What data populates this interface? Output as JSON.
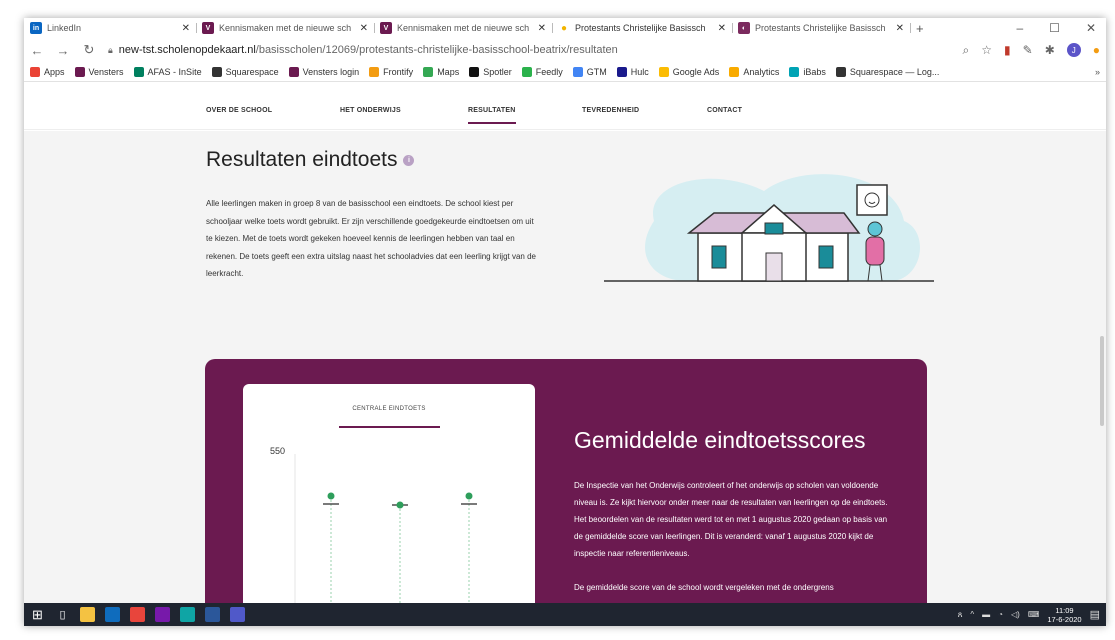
{
  "browser": {
    "tabs": [
      {
        "label": "LinkedIn",
        "icon": "linkedin-icon",
        "color": "#0a66c2",
        "glyph": "in",
        "active": false
      },
      {
        "label": "Kennismaken met de nieuwe sch",
        "icon": "vensters-icon",
        "color": "#6b1a50",
        "glyph": "V",
        "active": false
      },
      {
        "label": "Kennismaken met de nieuwe sch",
        "icon": "vensters-icon",
        "color": "#6b1a50",
        "glyph": "V",
        "active": false
      },
      {
        "label": "Protestants Christelijke Basissch",
        "icon": "scholen-icon",
        "color": "#f2b400",
        "glyph": "●",
        "active": true
      },
      {
        "label": "Protestants Christelijke Basissch",
        "icon": "scholen-icon",
        "color": "#7b2a5e",
        "glyph": "◐",
        "active": false
      }
    ],
    "new_tab": "+",
    "window_controls": [
      "–",
      "☐",
      "✕"
    ],
    "url_domain": "new-tst.scholenopdekaart.nl",
    "url_path": "/basisscholen/12069/protestants-christelijke-basisschool-beatrix/resultaten",
    "account_initial": "J",
    "bookmarks": [
      {
        "label": "Apps",
        "color": "#ea4335"
      },
      {
        "label": "Vensters",
        "color": "#6b1a50"
      },
      {
        "label": "AFAS - InSite",
        "color": "#00805f"
      },
      {
        "label": "Squarespace",
        "color": "#333333"
      },
      {
        "label": "Vensters login",
        "color": "#6b1a50"
      },
      {
        "label": "Frontify",
        "color": "#f39c12"
      },
      {
        "label": "Maps",
        "color": "#34a853"
      },
      {
        "label": "Spotler",
        "color": "#111111"
      },
      {
        "label": "Feedly",
        "color": "#2bb24c"
      },
      {
        "label": "GTM",
        "color": "#4285f4"
      },
      {
        "label": "Hulc",
        "color": "#1a1a8c"
      },
      {
        "label": "Google Ads",
        "color": "#fbbc04"
      },
      {
        "label": "Analytics",
        "color": "#f9ab00"
      },
      {
        "label": "iBabs",
        "color": "#00a3b4"
      },
      {
        "label": "Squarespace — Log...",
        "color": "#333333"
      }
    ],
    "bookmarks_more": "»"
  },
  "site_nav": [
    {
      "label": "OVER DE SCHOOL",
      "active": false
    },
    {
      "label": "HET ONDERWIJS",
      "active": false
    },
    {
      "label": "RESULTATEN",
      "active": true
    },
    {
      "label": "TEVREDENHEID",
      "active": false
    },
    {
      "label": "CONTACT",
      "active": false
    }
  ],
  "page": {
    "title": "Resultaten eindtoets",
    "info_glyph": "i",
    "intro": "Alle leerlingen maken in groep 8 van de basisschool een eindtoets. De school kiest per schooljaar welke toets wordt gebruikt. Er zijn verschillende goedgekeurde eindtoetsen om uit te kiezen. Met de toets wordt gekeken hoeveel kennis de leerlingen hebben van taal en rekenen. De toets geeft een extra uitslag naast het schooladvies dat een leerling krijgt van de leerkracht."
  },
  "panel": {
    "card_tab": "CENTRALE EINDTOETS",
    "y_label": "550",
    "title": "Gemiddelde eindtoetsscores",
    "paragraph1": "De Inspectie van het Onderwijs controleert of het onderwijs op scholen van voldoende niveau is. Ze kijkt hiervoor onder meer naar de resultaten van leerlingen op de eindtoets. Het beoordelen van de resultaten werd tot en met 1 augustus 2020 gedaan op basis van de gemiddelde score van leerlingen. Dit is veranderd: vanaf 1 augustus 2020 kijkt de inspectie naar referentieniveaus.",
    "paragraph2": "De gemiddelde score van de school wordt vergeleken met de ondergrens"
  },
  "chart_data": {
    "type": "scatter",
    "y_tick": 550,
    "points_relative_to_line": [
      "above",
      "on",
      "above"
    ],
    "colors": {
      "point": "#2e9e5b",
      "line": "#333333",
      "stem": "#9ad1ae"
    }
  },
  "taskbar": {
    "time": "11:09",
    "date": "17-6-2020",
    "apps": [
      {
        "icon": "windows-start-icon",
        "color": "#1f2530"
      },
      {
        "icon": "task-view-icon",
        "color": "#1f2530"
      },
      {
        "icon": "file-explorer-icon",
        "color": "#f4c242"
      },
      {
        "icon": "outlook-icon",
        "color": "#0f6cbd"
      },
      {
        "icon": "chrome-icon",
        "color": "#e8453c"
      },
      {
        "icon": "onenote-icon",
        "color": "#7719aa"
      },
      {
        "icon": "edge-icon",
        "color": "#0fa5a5"
      },
      {
        "icon": "word-icon",
        "color": "#2b579a"
      },
      {
        "icon": "teams-icon",
        "color": "#5059c9"
      }
    ]
  }
}
